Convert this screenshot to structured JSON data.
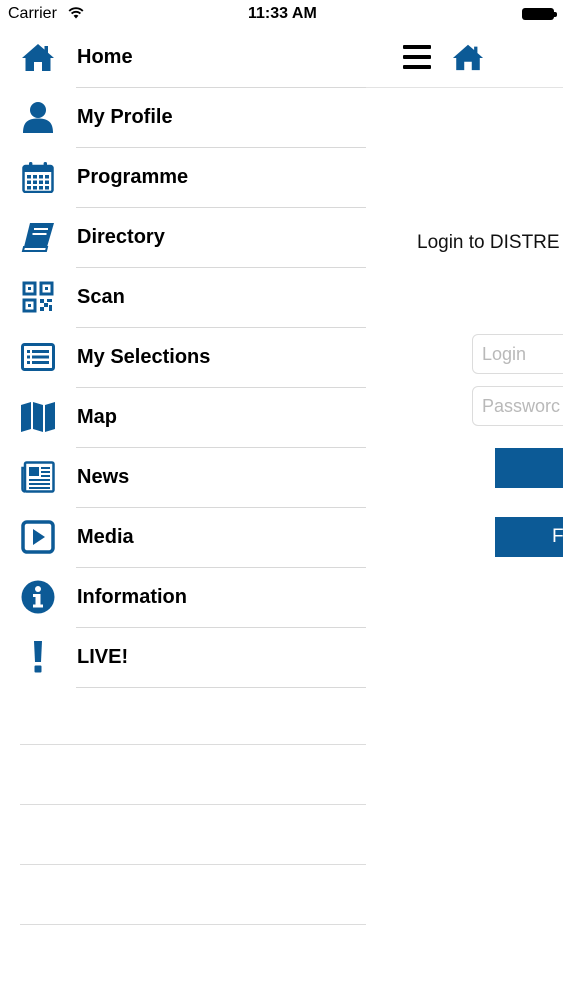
{
  "status_bar": {
    "carrier": "Carrier",
    "time": "11:33 AM"
  },
  "colors": {
    "accent": "#0c5a96"
  },
  "menu": {
    "items": [
      {
        "label": "Home",
        "icon": "home-icon"
      },
      {
        "label": "My Profile",
        "icon": "user-icon"
      },
      {
        "label": "Programme",
        "icon": "calendar-icon"
      },
      {
        "label": "Directory",
        "icon": "book-icon"
      },
      {
        "label": "Scan",
        "icon": "qr-code-icon"
      },
      {
        "label": "My Selections",
        "icon": "list-icon"
      },
      {
        "label": "Map",
        "icon": "map-icon"
      },
      {
        "label": "News",
        "icon": "newspaper-icon"
      },
      {
        "label": "Media",
        "icon": "play-icon"
      },
      {
        "label": "Information",
        "icon": "info-icon"
      },
      {
        "label": "LIVE!",
        "icon": "exclamation-icon"
      }
    ]
  },
  "main": {
    "title": "Login to DISTRE",
    "login_placeholder": "Login",
    "password_placeholder": "Passworc",
    "button_1_label": "",
    "button_2_label": "F"
  }
}
